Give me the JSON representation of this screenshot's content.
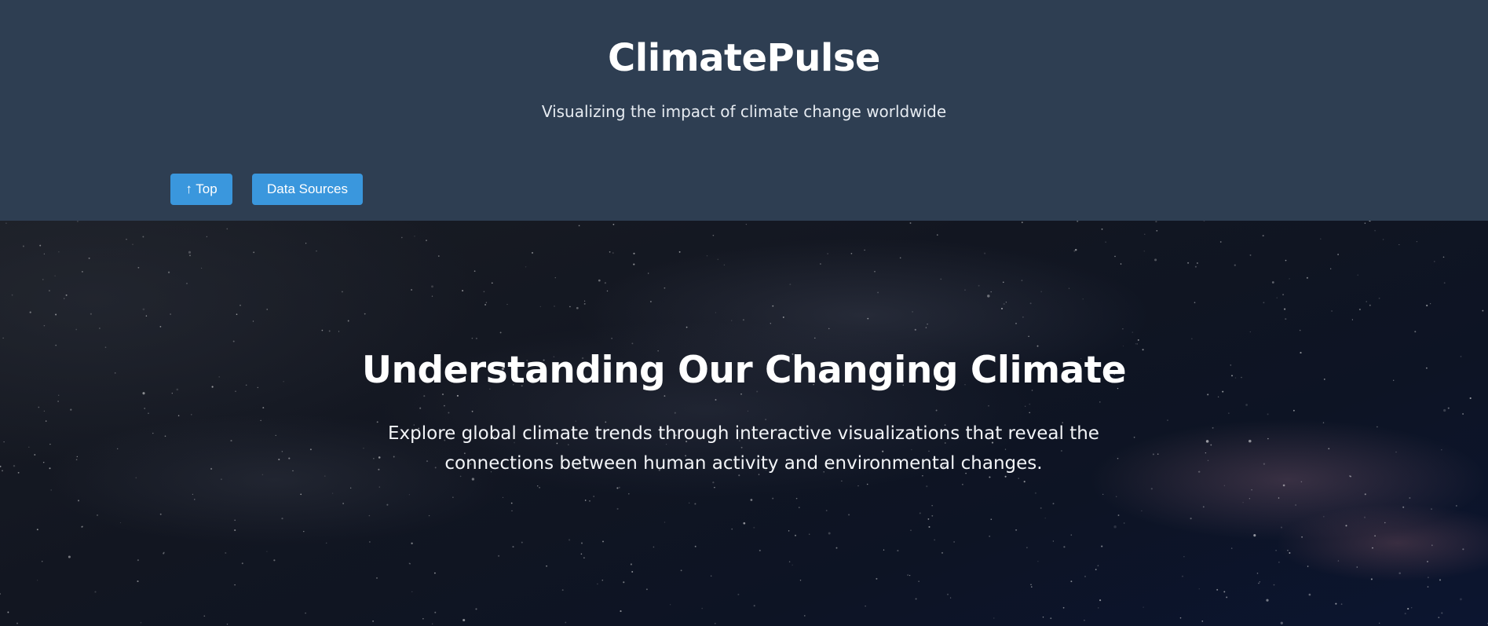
{
  "header": {
    "title": "ClimatePulse",
    "tagline": "Visualizing the impact of climate change worldwide",
    "background_color": "#2e3e52"
  },
  "nav": {
    "top_label": "↑ Top",
    "data_sources_label": "Data Sources",
    "button_color": "#3a97dd"
  },
  "hero": {
    "heading": "Understanding Our Changing Climate",
    "text": "Explore global climate trends through interactive visualizations that reveal the connections between human activity and environmental changes.",
    "background": "starry night sky"
  }
}
